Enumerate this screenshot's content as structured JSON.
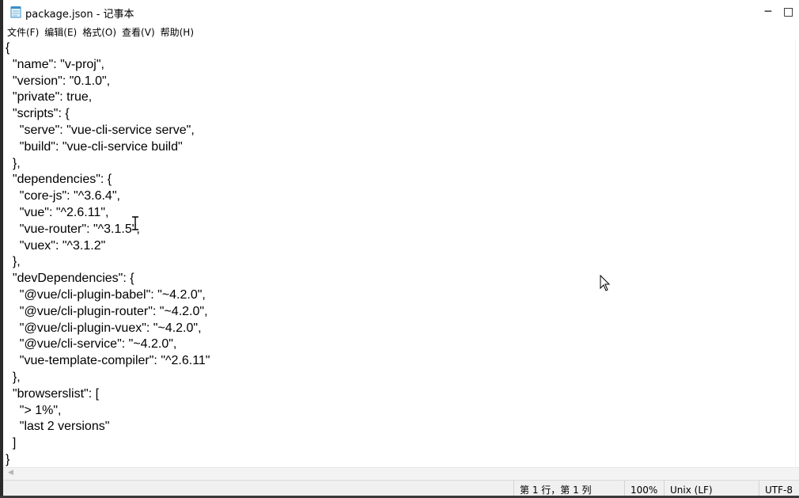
{
  "window": {
    "title": "package.json - 记事本",
    "minimize_glyph": "─",
    "maximize_glyph": "□",
    "app_icon": "notepad-icon"
  },
  "menu": {
    "items": [
      {
        "label": "文件(F)"
      },
      {
        "label": "编辑(E)"
      },
      {
        "label": "格式(O)"
      },
      {
        "label": "查看(V)"
      },
      {
        "label": "帮助(H)"
      }
    ]
  },
  "editor": {
    "content": "{\n  \"name\": \"v-proj\",\n  \"version\": \"0.1.0\",\n  \"private\": true,\n  \"scripts\": {\n    \"serve\": \"vue-cli-service serve\",\n    \"build\": \"vue-cli-service build\"\n  },\n  \"dependencies\": {\n    \"core-js\": \"^3.6.4\",\n    \"vue\": \"^2.6.11\",\n    \"vue-router\": \"^3.1.5\",\n    \"vuex\": \"^3.1.2\"\n  },\n  \"devDependencies\": {\n    \"@vue/cli-plugin-babel\": \"~4.2.0\",\n    \"@vue/cli-plugin-router\": \"~4.2.0\",\n    \"@vue/cli-plugin-vuex\": \"~4.2.0\",\n    \"@vue/cli-service\": \"~4.2.0\",\n    \"vue-template-compiler\": \"^2.6.11\"\n  },\n  \"browserslist\": [\n    \"> 1%\",\n    \"last 2 versions\"\n  ]\n}"
  },
  "status": {
    "position": "第 1 行，第 1 列",
    "zoom": "100%",
    "line_ending": "Unix (LF)",
    "encoding": "UTF-8"
  },
  "icons": {
    "text_cursor": "ibeam-cursor-icon",
    "mouse_pointer": "arrow-pointer-icon",
    "scroll_left": "scroll-left-arrow-icon"
  }
}
